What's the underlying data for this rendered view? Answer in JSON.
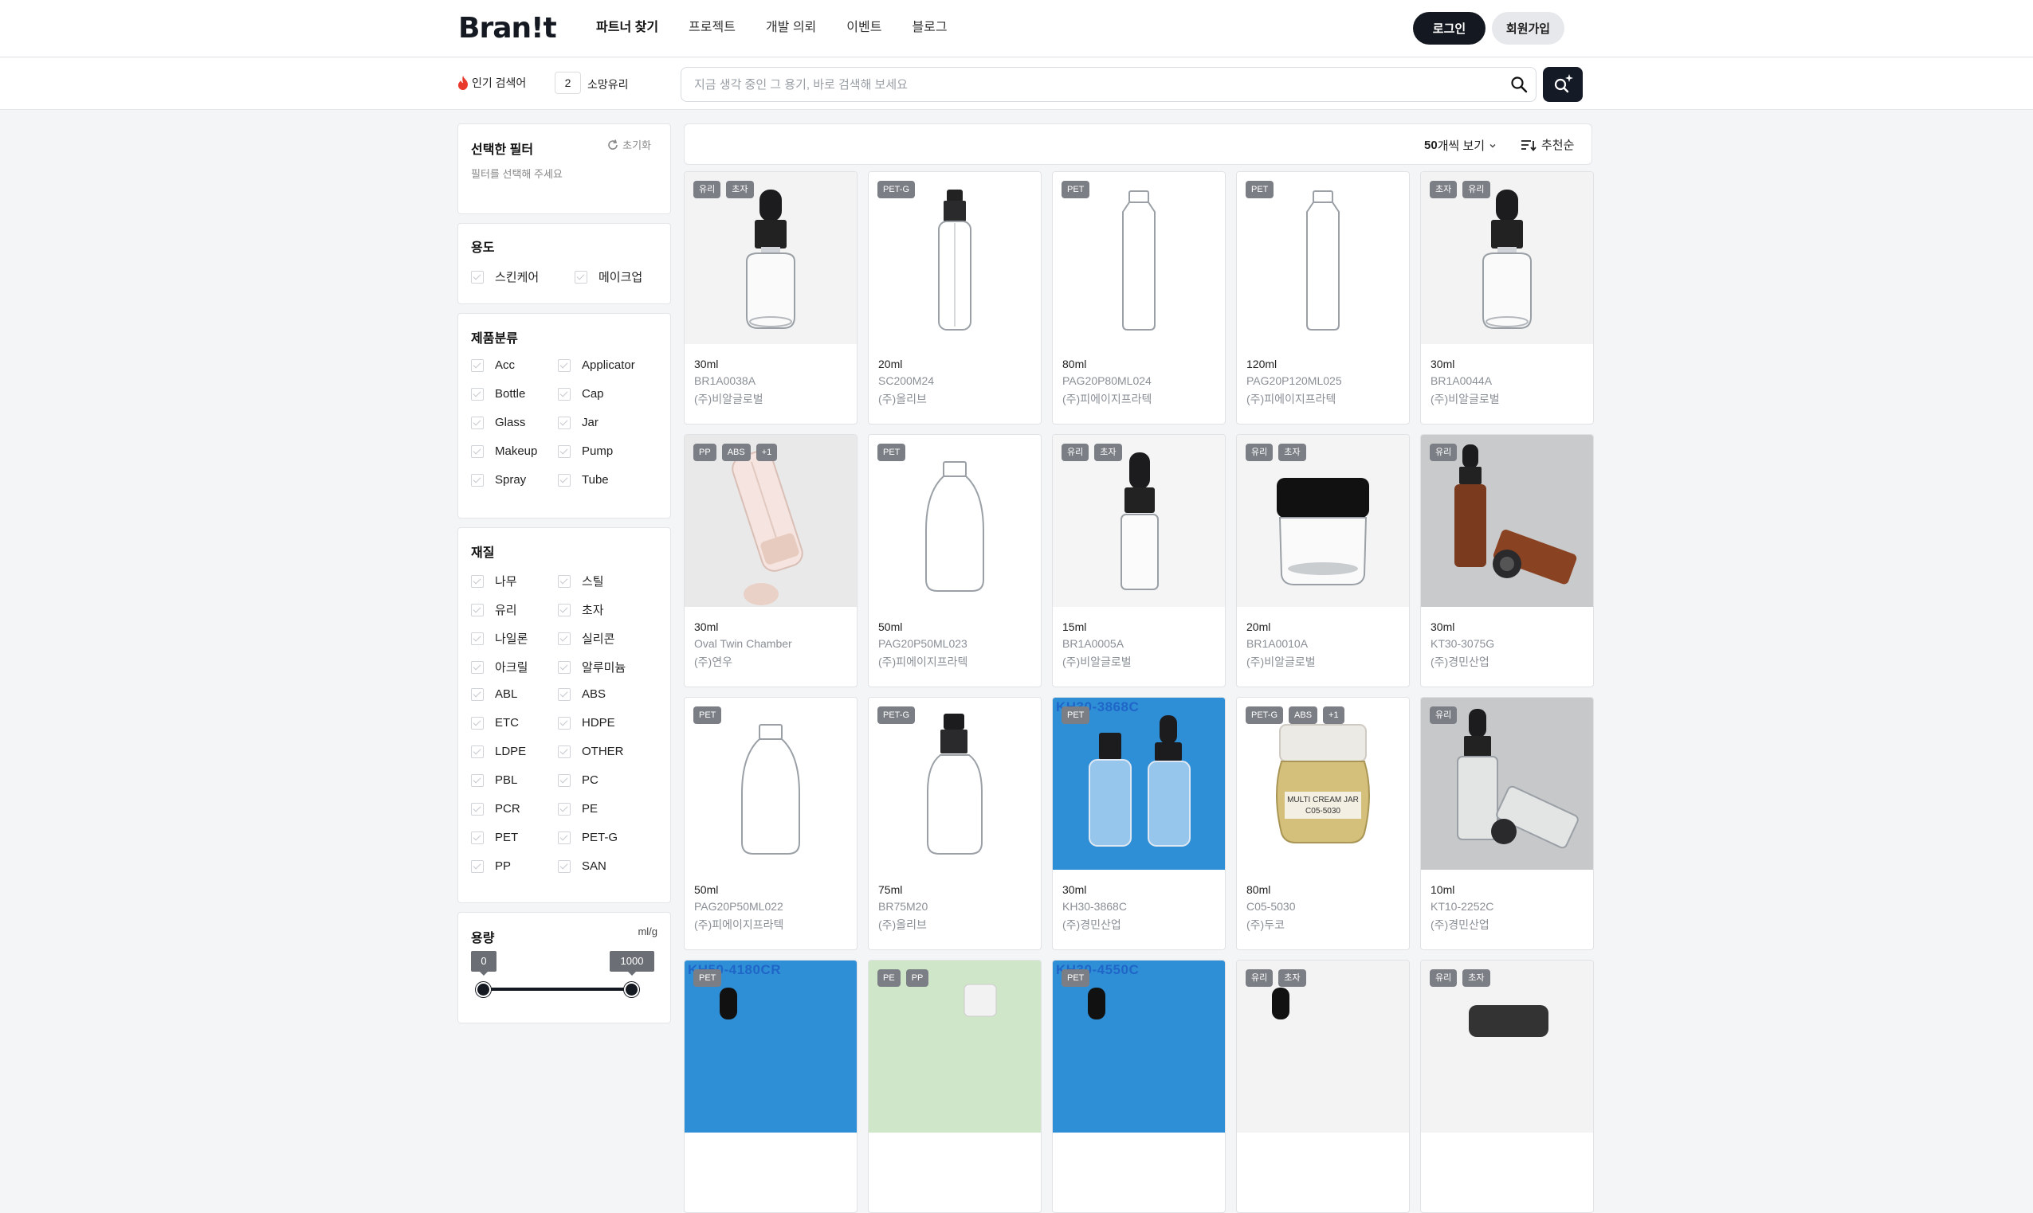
{
  "header": {
    "logo": "Bran!t",
    "nav": [
      "파트너 찾기",
      "프로젝트",
      "개발 의뢰",
      "이벤트",
      "블로그"
    ],
    "login": "로그인",
    "signup": "회원가입"
  },
  "search": {
    "popular_label": "인기 검색어",
    "rank": "2",
    "term": "소망유리",
    "placeholder": "지금 생각 중인 그 용기, 바로 검색해 보세요"
  },
  "filters": {
    "selected_title": "선택한 필터",
    "reset": "초기화",
    "hint": "필터를 선택해 주세요",
    "usage": {
      "title": "용도",
      "options": [
        "스킨케어",
        "메이크업"
      ]
    },
    "category": {
      "title": "제품분류",
      "options": [
        "Acc",
        "Applicator",
        "Bottle",
        "Cap",
        "Glass",
        "Jar",
        "Makeup",
        "Pump",
        "Spray",
        "Tube"
      ]
    },
    "material": {
      "title": "재질",
      "options": [
        "나무",
        "스틸",
        "유리",
        "초자",
        "나일론",
        "실리콘",
        "아크릴",
        "알루미늄",
        "ABL",
        "ABS",
        "ETC",
        "HDPE",
        "LDPE",
        "OTHER",
        "PBL",
        "PC",
        "PCR",
        "PE",
        "PET",
        "PET-G",
        "PP",
        "SAN"
      ]
    },
    "capacity": {
      "title": "용량",
      "unit": "ml/g",
      "min": "0",
      "max": "1000"
    }
  },
  "toolbar": {
    "per_page_num": "50",
    "per_page_suffix": "개씩 보기",
    "sort": "추천순"
  },
  "products": [
    {
      "badges": [
        "유리",
        "초자"
      ],
      "volume": "30ml",
      "model": "BR1A0038A",
      "company": "(주)비알글로벌"
    },
    {
      "badges": [
        "PET-G"
      ],
      "volume": "20ml",
      "model": "SC200M24",
      "company": "(주)올리브"
    },
    {
      "badges": [
        "PET"
      ],
      "volume": "80ml",
      "model": "PAG20P80ML024",
      "company": "(주)피에이지프라텍"
    },
    {
      "badges": [
        "PET"
      ],
      "volume": "120ml",
      "model": "PAG20P120ML025",
      "company": "(주)피에이지프라텍"
    },
    {
      "badges": [
        "초자",
        "유리"
      ],
      "volume": "30ml",
      "model": "BR1A0044A",
      "company": "(주)비알글로벌"
    },
    {
      "badges": [
        "PP",
        "ABS",
        "+1"
      ],
      "volume": "30ml",
      "model": "Oval Twin Chamber",
      "company": "(주)연우"
    },
    {
      "badges": [
        "PET"
      ],
      "volume": "50ml",
      "model": "PAG20P50ML023",
      "company": "(주)피에이지프라텍"
    },
    {
      "badges": [
        "유리",
        "초자"
      ],
      "volume": "15ml",
      "model": "BR1A0005A",
      "company": "(주)비알글로벌"
    },
    {
      "badges": [
        "유리",
        "초자"
      ],
      "volume": "20ml",
      "model": "BR1A0010A",
      "company": "(주)비알글로벌"
    },
    {
      "badges": [
        "유리"
      ],
      "volume": "30ml",
      "model": "KT30-3075G",
      "company": "(주)경민산업"
    },
    {
      "badges": [
        "PET"
      ],
      "volume": "50ml",
      "model": "PAG20P50ML022",
      "company": "(주)피에이지프라텍"
    },
    {
      "badges": [
        "PET-G"
      ],
      "volume": "75ml",
      "model": "BR75M20",
      "company": "(주)올리브"
    },
    {
      "badges": [
        "PET"
      ],
      "volume": "30ml",
      "model": "KH30-3868C",
      "company": "(주)경민산업",
      "watermark": "KH30-3868C"
    },
    {
      "badges": [
        "PET-G",
        "ABS",
        "+1"
      ],
      "volume": "80ml",
      "model": "C05-5030",
      "company": "(주)두코",
      "label_lines": [
        "MULTI CREAM JAR",
        "C05-5030"
      ]
    },
    {
      "badges": [
        "유리"
      ],
      "volume": "10ml",
      "model": "KT10-2252C",
      "company": "(주)경민산업"
    },
    {
      "badges": [
        "PET"
      ],
      "watermark": "KH50-4180CR"
    },
    {
      "badges": [
        "PE",
        "PP"
      ]
    },
    {
      "badges": [
        "PET"
      ],
      "watermark": "KH30-4550C"
    },
    {
      "badges": [
        "유리",
        "초자"
      ]
    },
    {
      "badges": [
        "유리",
        "초자"
      ]
    }
  ]
}
